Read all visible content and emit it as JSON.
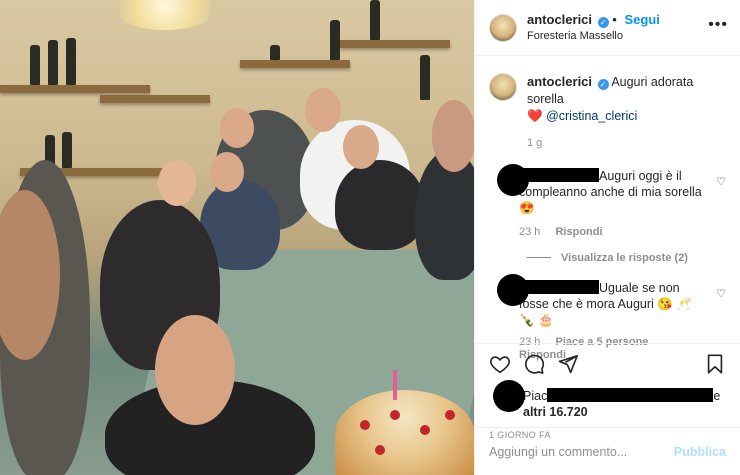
{
  "post": {
    "username": "antoclerici",
    "follow_label": "Segui",
    "location": "Foresteria Massello",
    "more_icon": "more-horizontal-icon"
  },
  "caption": {
    "username": "antoclerici",
    "text": "Auguri adorata sorella",
    "emoji": "❤️",
    "mention": "@cristina_clerici",
    "time": "1 g"
  },
  "comments": [
    {
      "text_a": "Auguri oggi è il",
      "text_b": "compleanno anche di mia sorella",
      "emoji": "😍",
      "time": "23 h",
      "reply_label": "Rispondi"
    },
    {
      "text_a": "Uguale se non",
      "text_b": "fosse che è mora Auguri 😘 🥂",
      "emoji": "🍾 🎂",
      "time": "23 h",
      "likes_label": "Piace a 5 persone",
      "reply_label": "Rispondi"
    }
  ],
  "view_replies_label": "Visualizza le risposte (2)",
  "likes": {
    "prefix": "Piac",
    "suffix": "e",
    "others": "altri 16.720"
  },
  "date_label": "1 GIORNO FA",
  "composer": {
    "placeholder": "Aggiungi un commento...",
    "publish_label": "Pubblica"
  },
  "colors": {
    "link_blue": "#0095f6",
    "mention_blue": "#00376b",
    "meta_gray": "#8e8e8e"
  }
}
